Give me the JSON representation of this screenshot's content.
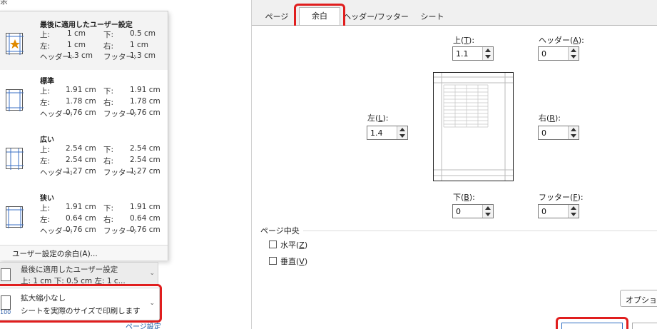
{
  "flyout": {
    "clipped_title": "余",
    "presets": [
      {
        "name": "最後に適用したユーザー設定",
        "top_label": "上:",
        "top_value": "1 cm",
        "bottom_label": "下:",
        "bottom_value": "0.5 cm",
        "left_label": "左:",
        "left_value": "1 cm",
        "right_label": "右:",
        "right_value": "1 cm",
        "header_label": "ヘッダー:",
        "header_value": "1.3 cm",
        "footer_label": "フッター:",
        "footer_value": "1.3 cm"
      },
      {
        "name": "標準",
        "top_label": "上:",
        "top_value": "1.91 cm",
        "bottom_label": "下:",
        "bottom_value": "1.91 cm",
        "left_label": "左:",
        "left_value": "1.78 cm",
        "right_label": "右:",
        "right_value": "1.78 cm",
        "header_label": "ヘッダー:",
        "header_value": "0.76 cm",
        "footer_label": "フッター:",
        "footer_value": "0.76 cm"
      },
      {
        "name": "広い",
        "top_label": "上:",
        "top_value": "2.54 cm",
        "bottom_label": "下:",
        "bottom_value": "2.54 cm",
        "left_label": "左:",
        "left_value": "2.54 cm",
        "right_label": "右:",
        "right_value": "2.54 cm",
        "header_label": "ヘッダー:",
        "header_value": "1.27 cm",
        "footer_label": "フッター:",
        "footer_value": "1.27 cm"
      },
      {
        "name": "狭い",
        "top_label": "上:",
        "top_value": "1.91 cm",
        "bottom_label": "下:",
        "bottom_value": "1.91 cm",
        "left_label": "左:",
        "left_value": "0.64 cm",
        "right_label": "右:",
        "right_value": "0.64 cm",
        "header_label": "ヘッダー:",
        "header_value": "0.76 cm",
        "footer_label": "フッター:",
        "footer_value": "0.76 cm"
      }
    ],
    "custom_margins_label": "ユーザー設定の余白(A)..."
  },
  "margin_dropdown": {
    "line1": "最後に適用したユーザー設定",
    "line2": "上: 1 cm 下: 0.5 cm 左: 1 c..."
  },
  "scaling_dropdown": {
    "line1": "拡大縮小なし",
    "line2": "シートを実際のサイズで印刷します",
    "icon_text": "100"
  },
  "page_setup_link": "ページ設定",
  "dialog": {
    "tabs": [
      "ページ",
      "余白",
      "ヘッダー/フッター",
      "シート"
    ],
    "active_tab": "余白",
    "fields": {
      "top": {
        "label_pre": "上(",
        "key": "T",
        "label_post": "):",
        "value": "1.1"
      },
      "header": {
        "label_pre": "ヘッダー(",
        "key": "A",
        "label_post": "):",
        "value": "0"
      },
      "left": {
        "label_pre": "左(",
        "key": "L",
        "label_post": "):",
        "value": "1.4"
      },
      "right": {
        "label_pre": "右(",
        "key": "R",
        "label_post": "):",
        "value": "0"
      },
      "bottom": {
        "label_pre": "下(",
        "key": "B",
        "label_post": "):",
        "value": "0"
      },
      "footer": {
        "label_pre": "フッター(",
        "key": "F",
        "label_post": "):",
        "value": "0"
      }
    },
    "center_group": {
      "title": "ページ中央",
      "horizontal": {
        "label_pre": "水平(",
        "key": "Z",
        "label_post": ")",
        "checked": false
      },
      "vertical": {
        "label_pre": "垂直(",
        "key": "V",
        "label_post": ")",
        "checked": false
      }
    },
    "options_button": "オプション"
  },
  "colors": {
    "highlight": "#e01e1e",
    "link": "#1f5fa8",
    "icon_star": "#e08a00"
  }
}
